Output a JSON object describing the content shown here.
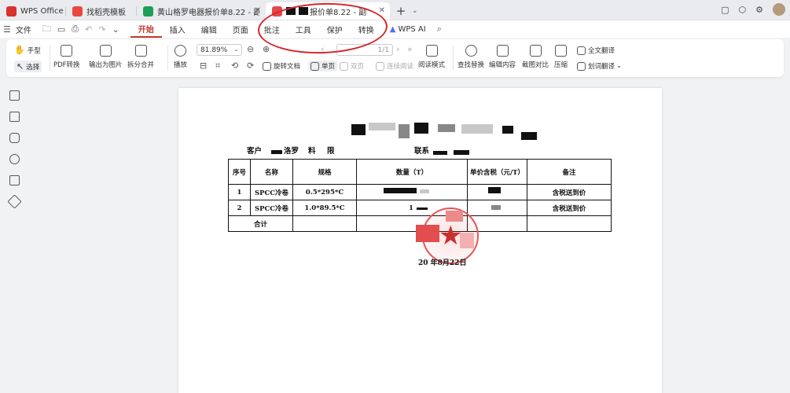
{
  "tabs": [
    {
      "label": "WPS Office",
      "icon": "wps-logo-icon",
      "color": "#d9312c"
    },
    {
      "label": "找稻壳模板",
      "icon": "docer-icon",
      "color": "#e8483f"
    },
    {
      "label": "黄山格罗电器报价单8.22 - 副本.xl",
      "icon": "spreadsheet-icon",
      "color": "#1e9e5a"
    },
    {
      "label": "报价单8.22 - 副",
      "icon": "pdf-icon",
      "color": "#e5484d"
    }
  ],
  "menu": {
    "file": "文件",
    "items": [
      "开始",
      "插入",
      "编辑",
      "页面",
      "批注",
      "工具",
      "保护",
      "转换"
    ],
    "wps_ai": "WPS AI"
  },
  "toolbar": {
    "hand": "手型",
    "select": "选择",
    "pdf_convert": "PDF转换",
    "export_image": "输出为图片",
    "split_merge": "拆分合并",
    "play": "播放",
    "zoom": "81.89%",
    "page": "1/1",
    "rotate": "旋转文档",
    "single": "单页",
    "double": "双页",
    "continuous": "连续阅读",
    "read_mode": "阅读模式",
    "find_replace": "查找替换",
    "edit_content": "编辑内容",
    "screenshot_compare": "截图对比",
    "compress": "压缩",
    "full_translate": "全文翻译",
    "word_translate": "划词翻译"
  },
  "document": {
    "customer_label": "客户",
    "customer_partial": "洛罗",
    "material_partial": "料",
    "limited_partial": "限",
    "contact_label": "联系",
    "table": {
      "headers": [
        "序号",
        "名称",
        "规格",
        "数量（T）",
        "单价含税（元/T）",
        "备注"
      ],
      "rows": [
        {
          "no": "1",
          "name": "SPCC冷卷",
          "spec": "0.5*295*C",
          "qty": "",
          "price": "",
          "note": "含税送到价"
        },
        {
          "no": "2",
          "name": "SPCC冷卷",
          "spec": "1.0*89.5*C",
          "qty": "1",
          "price": "",
          "note": "含税送到价"
        }
      ],
      "total_label": "合计"
    },
    "date": "20  年8月22日"
  },
  "colors": {
    "accent": "#c0392b",
    "annotation": "#d4262a",
    "stamp": "#e85555"
  }
}
